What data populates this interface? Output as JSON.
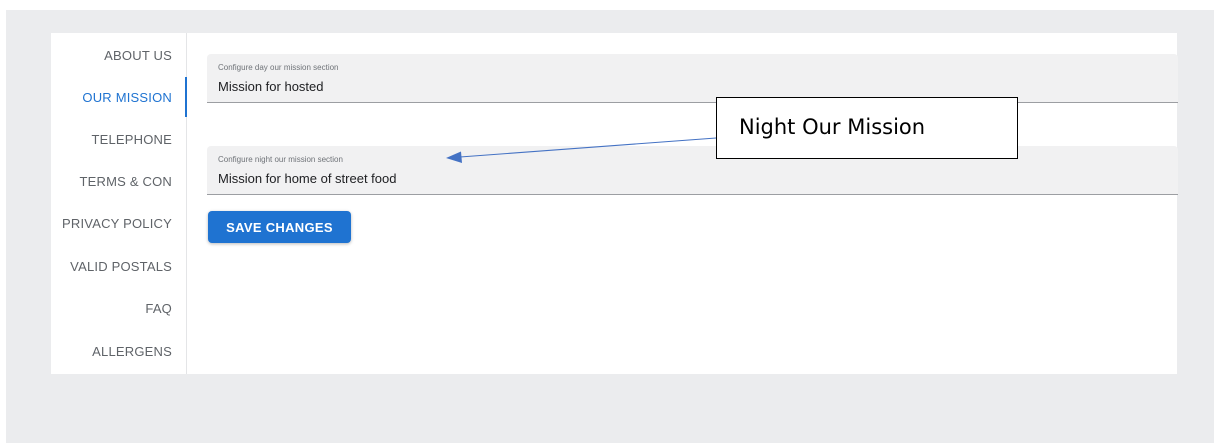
{
  "sidebar": {
    "items": [
      {
        "label": "ABOUT US"
      },
      {
        "label": "OUR MISSION"
      },
      {
        "label": "TELEPHONE"
      },
      {
        "label": "TERMS & CON"
      },
      {
        "label": "PRIVACY POLICY"
      },
      {
        "label": "VALID POSTALS"
      },
      {
        "label": "FAQ"
      },
      {
        "label": "ALLERGENS"
      }
    ],
    "active_index": 1
  },
  "form": {
    "day_field": {
      "label": "Configure day our mission section",
      "value": "Mission for hosted"
    },
    "night_field": {
      "label": "Configure night our mission section",
      "value": "Mission for home of street food"
    },
    "save_label": "SAVE CHANGES"
  },
  "annotation": {
    "text": "Night Our Mission",
    "arrow_color": "#4472c4"
  },
  "colors": {
    "accent": "#1f73d1",
    "backdrop": "#ebecee"
  }
}
